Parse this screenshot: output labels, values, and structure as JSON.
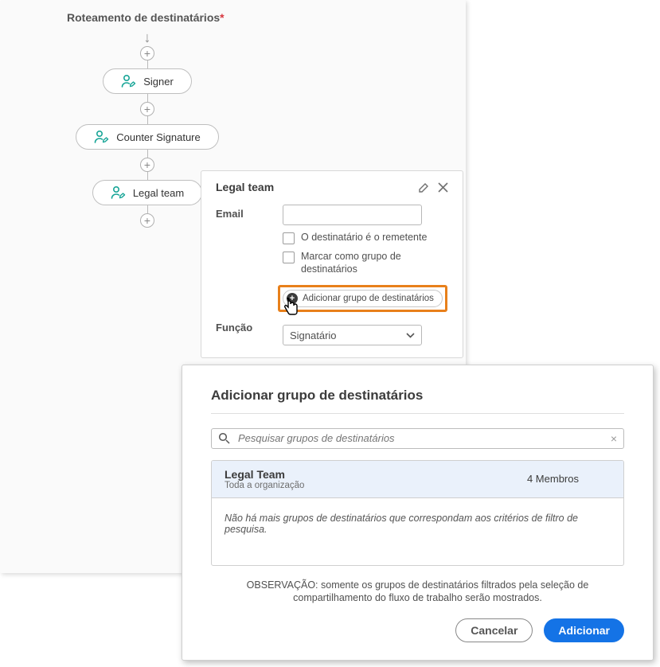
{
  "header": {
    "title": "Roteamento de destinatários"
  },
  "flow": {
    "nodes": [
      {
        "label": "Signer"
      },
      {
        "label": "Counter Signature"
      },
      {
        "label": "Legal team"
      }
    ]
  },
  "props": {
    "title": "Legal team",
    "email_label": "Email",
    "chk_sender": "O destinatário é o remetente",
    "chk_group": "Marcar como grupo de destinatários",
    "add_group_label": "Adicionar grupo de destinatários",
    "role_label": "Função",
    "role_value": "Signatário"
  },
  "modal": {
    "title": "Adicionar grupo de destinatários",
    "search_placeholder": "Pesquisar grupos de destinatários",
    "group": {
      "name": "Legal Team",
      "sub": "Toda a organização",
      "members": "4 Membros"
    },
    "empty": "Não há mais grupos de destinatários que correspondam aos critérios de filtro de pesquisa.",
    "note": "OBSERVAÇÃO: somente os grupos de destinatários filtrados pela seleção de compartilhamento do fluxo de trabalho serão mostrados.",
    "cancel": "Cancelar",
    "add": "Adicionar"
  }
}
